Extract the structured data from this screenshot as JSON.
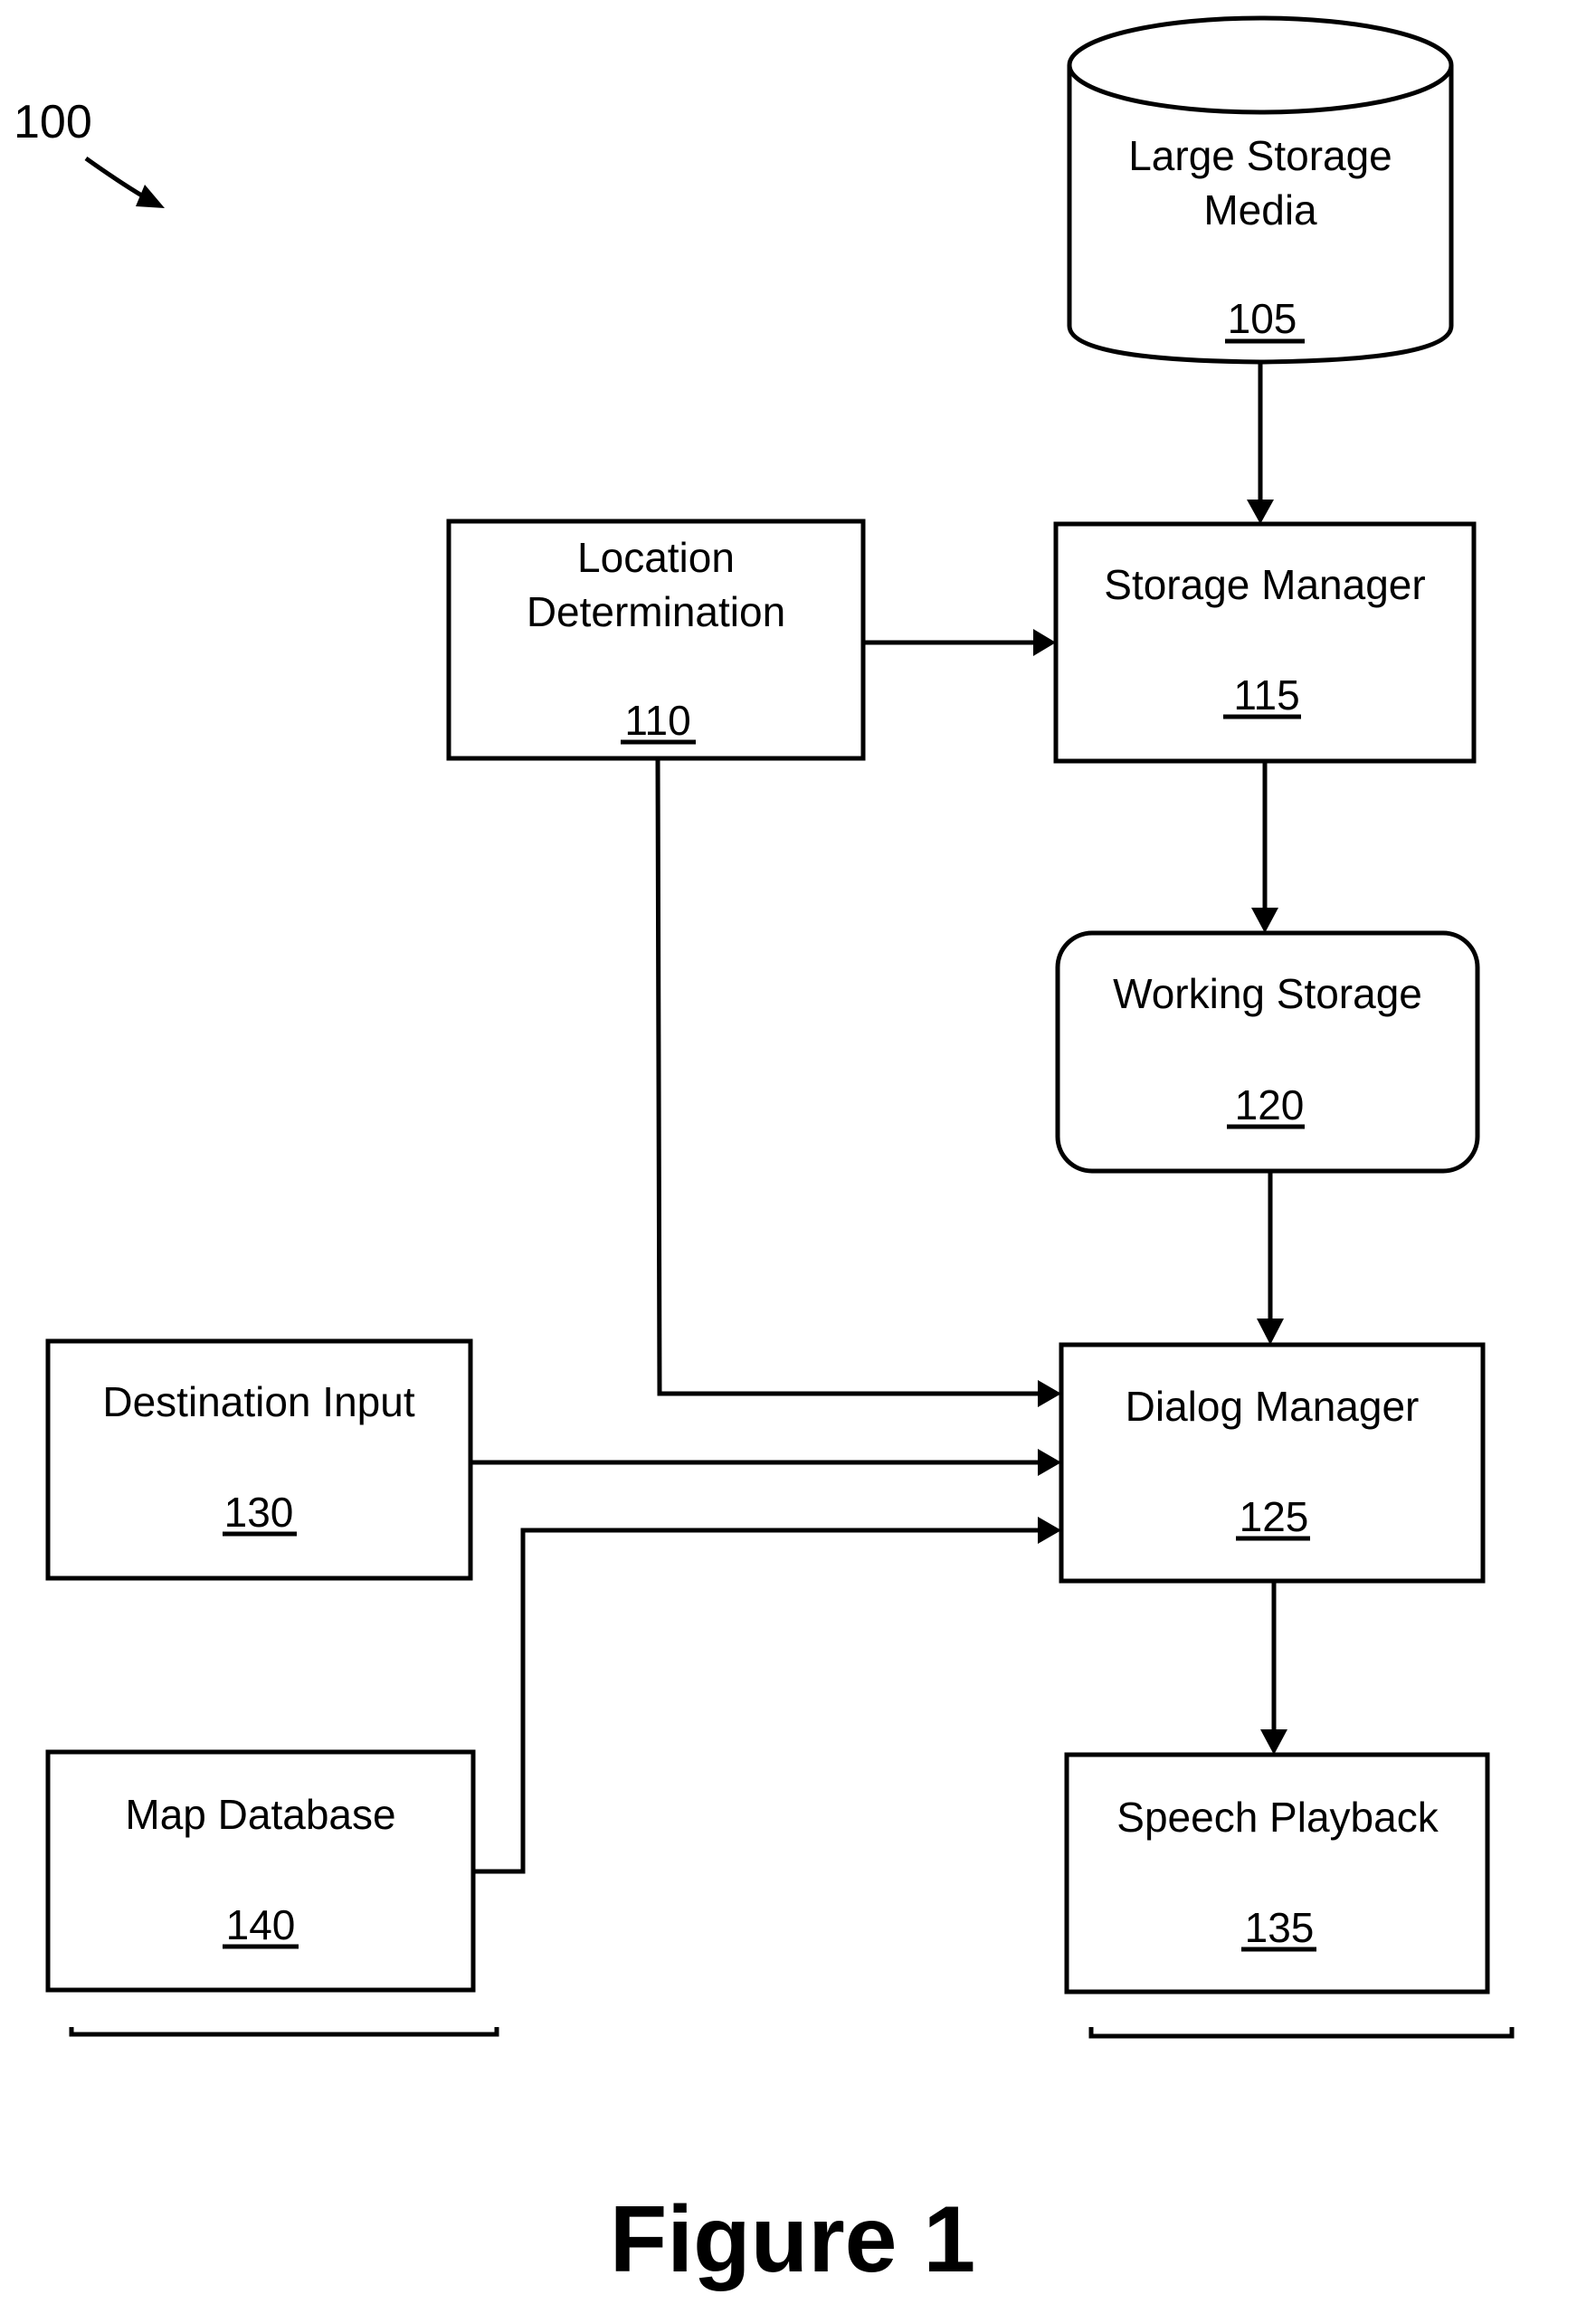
{
  "figure": {
    "reference_number": "100",
    "caption": "Figure 1"
  },
  "blocks": {
    "large_storage_media": {
      "label_line1": "Large Storage",
      "label_line2": "Media",
      "number": "105",
      "shape": "cylinder"
    },
    "location_determination": {
      "label_line1": "Location",
      "label_line2": "Determination",
      "number": "110",
      "shape": "rectangle"
    },
    "storage_manager": {
      "label": "Storage Manager",
      "number": "115",
      "shape": "rectangle"
    },
    "working_storage": {
      "label": "Working Storage",
      "number": "120",
      "shape": "rounded-rectangle"
    },
    "dialog_manager": {
      "label": "Dialog Manager",
      "number": "125",
      "shape": "rectangle"
    },
    "destination_input": {
      "label": "Destination Input",
      "number": "130",
      "shape": "rectangle"
    },
    "speech_playback": {
      "label": "Speech Playback",
      "number": "135",
      "shape": "rectangle"
    },
    "map_database": {
      "label": "Map Database",
      "number": "140",
      "shape": "rectangle"
    }
  },
  "connections": [
    {
      "from": "105",
      "to": "115"
    },
    {
      "from": "110",
      "to": "115"
    },
    {
      "from": "115",
      "to": "120"
    },
    {
      "from": "120",
      "to": "125"
    },
    {
      "from": "110",
      "to": "125"
    },
    {
      "from": "130",
      "to": "125"
    },
    {
      "from": "140",
      "to": "125"
    },
    {
      "from": "125",
      "to": "135"
    }
  ],
  "colors": {
    "ink": "#000000",
    "paper": "#ffffff"
  }
}
